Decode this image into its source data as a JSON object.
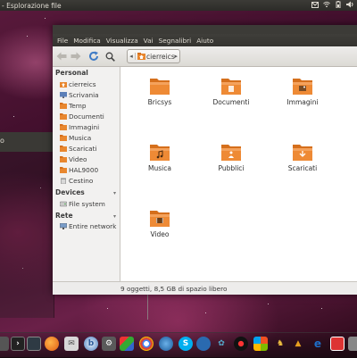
{
  "topbar": {
    "title": "- Esplorazione file",
    "tray": [
      "mail-icon",
      "wifi-icon",
      "battery-icon",
      "volume-icon"
    ]
  },
  "background_window": {
    "label": "o"
  },
  "window": {
    "menu": [
      "File",
      "Modifica",
      "Visualizza",
      "Vai",
      "Segnalibri",
      "Aiuto"
    ],
    "location": "cierreics",
    "sidebar": {
      "personal_header": "Personal",
      "personal": [
        {
          "label": "cierreics",
          "icon": "home-folder-icon"
        },
        {
          "label": "Scrivania",
          "icon": "desktop-icon"
        },
        {
          "label": "Temp",
          "icon": "folder-icon"
        },
        {
          "label": "Documenti",
          "icon": "folder-icon"
        },
        {
          "label": "Immagini",
          "icon": "folder-icon"
        },
        {
          "label": "Musica",
          "icon": "folder-icon"
        },
        {
          "label": "Scaricati",
          "icon": "folder-icon"
        },
        {
          "label": "Video",
          "icon": "folder-icon"
        },
        {
          "label": "HAL9000",
          "icon": "folder-icon"
        },
        {
          "label": "Cestino",
          "icon": "trash-icon"
        }
      ],
      "devices_header": "Devices",
      "devices": [
        {
          "label": "File system",
          "icon": "drive-icon"
        }
      ],
      "network_header": "Rete",
      "network": [
        {
          "label": "Entire network",
          "icon": "network-icon"
        }
      ]
    },
    "files": [
      {
        "label": "Bricsys",
        "emblem": ""
      },
      {
        "label": "Documenti",
        "emblem": "doc"
      },
      {
        "label": "Immagini",
        "emblem": "img"
      },
      {
        "label": "Musica",
        "emblem": "music"
      },
      {
        "label": "Pubblici",
        "emblem": "public"
      },
      {
        "label": "Scaricati",
        "emblem": "down"
      },
      {
        "label": "Video",
        "emblem": "video"
      }
    ],
    "status": "9 oggetti, 8,5 GB di spazio libero"
  },
  "dock": [
    "apps-icon",
    "terminal-icon",
    "monitor-icon",
    "firefox-icon",
    "mail-icon",
    "bluetooth-icon",
    "settings-icon",
    "media-icon",
    "chrome-icon",
    "ccleaner-icon",
    "skype-icon",
    "update-icon",
    "butterfly-icon",
    "hal-icon",
    "windows-icon",
    "chess-icon",
    "ie-icon",
    "calendar-icon",
    "app-icon"
  ],
  "colors": {
    "folder": "#e8872f",
    "panel": "#3c3b37",
    "accent": "#dd4814"
  }
}
